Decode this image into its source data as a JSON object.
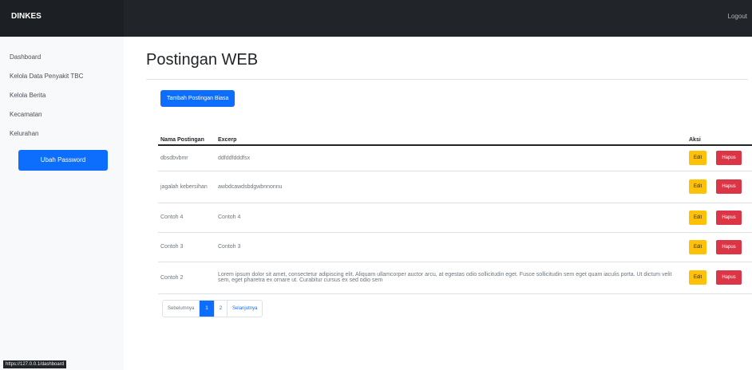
{
  "navbar": {
    "brand": "DINKES",
    "logout": "Logout"
  },
  "sidebar": {
    "items": [
      {
        "label": "Dashboard"
      },
      {
        "label": "Kelola Data Penyakit TBC"
      },
      {
        "label": "Kelola Berita"
      },
      {
        "label": "Kecamatan"
      },
      {
        "label": "Kelurahan"
      }
    ],
    "change_password": "Ubah Password"
  },
  "page": {
    "title": "Postingan WEB",
    "add_button": "Tambah Postingan Biasa"
  },
  "table": {
    "headers": {
      "name": "Nama Postingan",
      "excerpt": "Excerp",
      "action": "Aksi"
    },
    "rows": [
      {
        "name": "dbsdbvbmr",
        "excerpt": "ddfddfdddfsx",
        "edit": "Edit",
        "delete": "Hapus"
      },
      {
        "name": "jagalah kebersihan",
        "excerpt": "awbdcawdsbdgwbnnonnu",
        "edit": "Edit",
        "delete": "Hapus"
      },
      {
        "name": "Contoh 4",
        "excerpt": "Contoh 4",
        "edit": "Edit",
        "delete": "Hapus"
      },
      {
        "name": "Contoh 3",
        "excerpt": "Contoh 3",
        "edit": "Edit",
        "delete": "Hapus"
      },
      {
        "name": "Contoh 2",
        "excerpt": "Lorem ipsum dolor sit amet, consectetur adipiscing elit. Aliquam ullamcorper auctor arcu, at egestas odio sollicitudin eget. Fusce sollicitudin sem eget quam iaculis porta. Ut dictum velit sem, eget pharetra ex ornare ut. Curabitur cursus ex sed odio sem",
        "edit": "Edit",
        "delete": "Hapus"
      }
    ]
  },
  "pagination": {
    "previous": "Sebelumnya",
    "pages": [
      "1",
      "2"
    ],
    "next": "Selanjutnya"
  },
  "status_bar": {
    "url": "https://127.0.0.1/dashboard"
  }
}
